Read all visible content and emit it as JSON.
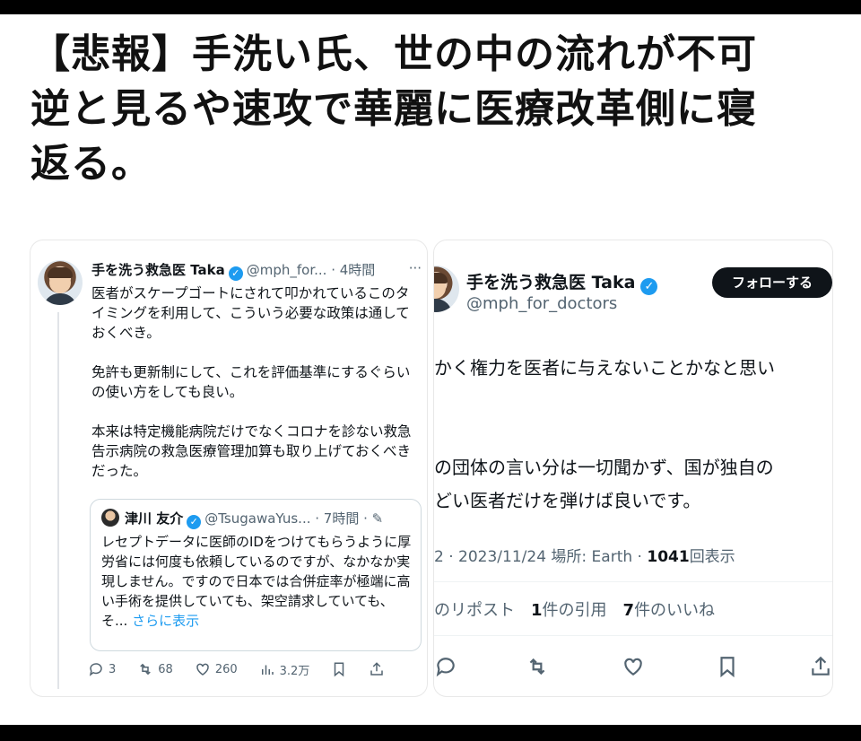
{
  "headline": {
    "line1": "【悲報】手洗い氏、世の中の流れが不可",
    "line2": "逆と見るや速攻で華麗に医療改革側に寝",
    "line3": "返る。"
  },
  "left_post": {
    "author_name": "手を洗う救急医 Taka",
    "handle": "@mph_for...",
    "time": "4時間",
    "more": "···",
    "paragraph1": "医者がスケープゴートにされて叩かれているこのタイミングを利用して、こういう必要な政策は通しておくべき。",
    "paragraph2": "免許も更新制にして、これを評価基準にするぐらいの使い方をしても良い。",
    "paragraph3": "本来は特定機能病院だけでなくコロナを診ない救急告示病院の救急医療管理加算も取り上げておくべきだった。",
    "quote": {
      "author_name": "津川 友介",
      "handle": "@TsugawaYus...",
      "time": "7時間",
      "text": "レセプトデータに医師のIDをつけてもらうように厚労省には何度も依頼しているのですが、なかなか実現しません。ですので日本では合併症率が極端に高い手術を提供していても、架空請求していても、そ...",
      "more_link": "さらに表示"
    },
    "actions": {
      "replies": "3",
      "reposts": "68",
      "likes": "260",
      "views": "3.2万"
    }
  },
  "right_post": {
    "author_name": "手を洗う救急医 Taka",
    "handle": "@mph_for_doctors",
    "follow_label": "フォローする",
    "text_line1": "かく権力を医者に与えないことかなと思い",
    "text_line2": "の団体の言い分は一切聞かず、国が独自の",
    "text_line3": "どい医者だけを弾けば良いです。",
    "meta_prefix": "2 · 2023/11/24 場所: Earth · ",
    "view_count": "1041",
    "view_suffix": "回表示",
    "reposts_label": "のリポスト",
    "quotes_count": "1",
    "quotes_label": "件の引用",
    "likes_count": "7",
    "likes_label": "件のいいね"
  },
  "icons": {
    "verified": "verified-badge-icon",
    "reply": "reply-icon",
    "repost": "repost-icon",
    "like": "heart-icon",
    "views": "views-icon",
    "bookmark": "bookmark-icon",
    "share": "share-icon"
  },
  "colors": {
    "verified_blue": "#1d9bf0",
    "muted_text": "#536471",
    "follow_button": "#0f1419"
  }
}
